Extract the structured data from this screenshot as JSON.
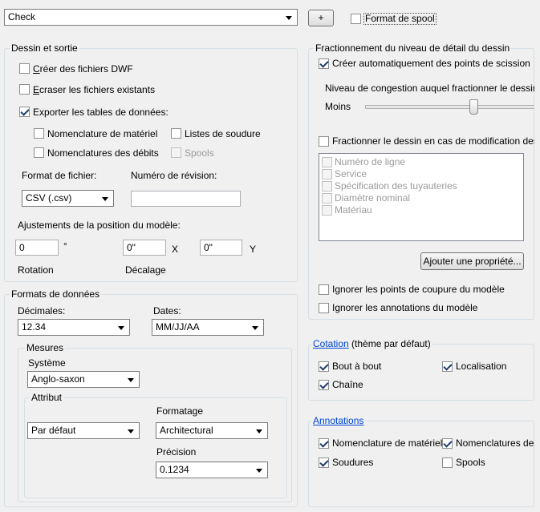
{
  "top": {
    "template_value": "Check",
    "add_button": "+",
    "spool_format_label": "Format de spool"
  },
  "drawing_output": {
    "title": "Dessin et sortie",
    "create_dwf": "Créer des fichiers DWF",
    "create_dwf_ul": "C",
    "create_dwf_rest": "réer des fichiers DWF",
    "overwrite_ul": "E",
    "overwrite_rest": "craser les fichiers existants",
    "export_tables": "Exporter les tables de données:",
    "bom": "Nomenclature de matériel",
    "weld_lists": "Listes de soudure",
    "cut_lists": "Nomenclatures des débits",
    "spools": "Spools",
    "file_format_label": "Format de fichier:",
    "file_format_value": "CSV (.csv)",
    "revision_label": "Numéro de révision:",
    "revision_value": "",
    "position_label": "Ajustements de la position du modèle:",
    "rotation_value": "0",
    "degree_symbol": "°",
    "offset_x_value": "0\"",
    "x_label": "X",
    "offset_y_value": "0\"",
    "y_label": "Y",
    "rotation_label": "Rotation",
    "offset_label": "Décalage"
  },
  "data_formats": {
    "title": "Formats de données",
    "decimals_label": "Décimales:",
    "decimals_value": "12.34",
    "dates_label": "Dates:",
    "dates_value": "MM/JJ/AA",
    "measures_title": "Mesures",
    "system_label": "Système",
    "system_value": "Anglo-saxon",
    "attribute_title": "Attribut",
    "attribute_value": "Par défaut",
    "formatting_label": "Formatage",
    "formatting_value": "Architectural",
    "precision_label": "Précision",
    "precision_value": "0.1234"
  },
  "split": {
    "title": "Fractionnement du niveau de détail du dessin",
    "auto_split": "Créer automatiquement des points de scission",
    "congestion_label": "Niveau de congestion auquel fractionner le dessin ISO",
    "less_label": "Moins",
    "slider_level": 0.62,
    "split_on_change": "Fractionner le dessin en cas de modification des propriétés",
    "properties": [
      "Numéro de ligne",
      "Service",
      "Spécification des tuyauteries",
      "Diamètre nominal",
      "Matériau"
    ],
    "add_property_button": "Ajouter une propriété...",
    "ignore_breakpoints": "Ignorer les points de coupure du modèle",
    "ignore_annotations": "Ignorer les annotations du modèle"
  },
  "dimensioning": {
    "title_link": "Cotation",
    "title_rest": " (thème par défaut)",
    "end_to_end": "Bout à bout",
    "location": "Localisation",
    "chain": "Chaîne"
  },
  "annotations": {
    "title_link": "Annotations",
    "bom": "Nomenclature de matériel",
    "cut_lists": "Nomenclatures des débits",
    "welds": "Soudures",
    "spools": "Spools"
  }
}
